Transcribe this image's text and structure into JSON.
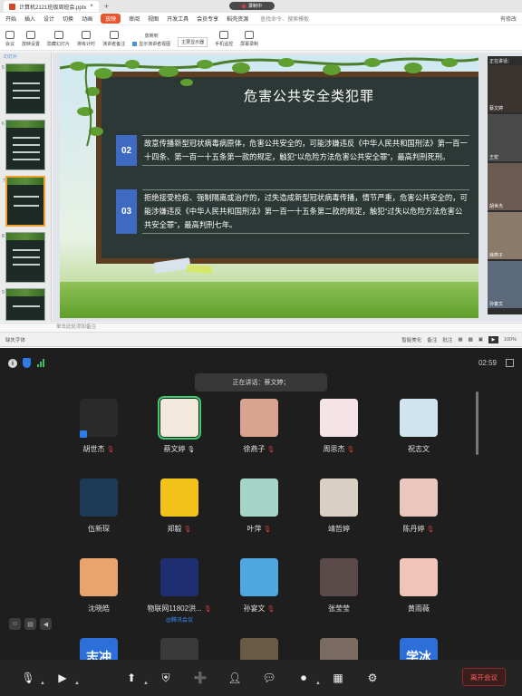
{
  "wps": {
    "doc_tab": "计算机2121班级周班会.pptx",
    "rec_label": "录制中",
    "menu": [
      "开始",
      "插入",
      "设计",
      "切换",
      "动画",
      "放映",
      "审阅",
      "视图",
      "开发工具",
      "会员专享",
      "稻壳资源"
    ],
    "menu_active": "放映",
    "search": "查找命令、搜索模板",
    "collab": "有修改",
    "ribbon": [
      "会议",
      "放映设置",
      "隐藏幻灯片",
      "排练计时",
      "演讲者备注",
      "放映到",
      "主要显示器",
      "显示演讲者视图",
      "手机遥控",
      "屏幕录制"
    ],
    "pane_label": "幻灯片",
    "thumb_numbers": [
      "5",
      "6",
      "7",
      "8",
      "9"
    ],
    "slide": {
      "title": "危害公共安全类犯罪",
      "items": [
        {
          "num": "02",
          "text": "故意传播新型冠状病毒病原体，危害公共安全的，可能涉嫌违反《中华人民共和国刑法》第一百一十四条、第一百一十五条第一款的规定，触犯“以危险方法危害公共安全罪”，最高判刑死刑。"
        },
        {
          "num": "03",
          "text": "拒绝接受检疫、强制隔离或治疗的，过失造成新型冠状病毒传播，情节严重，危害公共安全的，可能涉嫌违反《中华人民共和国刑法》第一百一十五条第二款的规定，触犯“过失以危险方法危害公共安全罪”，最高判刑七年。"
        }
      ]
    },
    "cam_label": "正在讲话：",
    "cams": [
      "蔡文婷",
      "王宏",
      "胡世杰",
      "徐燕子",
      "周思杰",
      "祝志文",
      "孙宴文"
    ],
    "notes": "单击此处添加备注",
    "status_left": "缺失字体",
    "status_right": [
      "智能美化",
      "备注",
      "批注",
      "100%"
    ]
  },
  "meeting": {
    "time": "02:59",
    "speaking": "正在讲话：蔡文婷；",
    "tiles": [
      {
        "name": "胡世杰",
        "mic": "off",
        "color": "#2a2a2a",
        "glyph": "",
        "host": true
      },
      {
        "name": "蔡文婷",
        "mic": "on",
        "color": "#f2e9dc",
        "glyph": "",
        "ring": true
      },
      {
        "name": "徐燕子",
        "mic": "off",
        "color": "#d9a38f",
        "glyph": ""
      },
      {
        "name": "周思杰",
        "mic": "off",
        "color": "#f6e3e8",
        "glyph": ""
      },
      {
        "name": "祝志文",
        "mic": "",
        "color": "#cfe4ef",
        "glyph": ""
      },
      {
        "name": "伍新琛",
        "mic": "",
        "color": "#1e3a55",
        "glyph": ""
      },
      {
        "name": "郑毅",
        "mic": "off",
        "color": "#f2c21a",
        "glyph": ""
      },
      {
        "name": "叶萍",
        "mic": "off",
        "color": "#a7d4c9",
        "glyph": ""
      },
      {
        "name": "靖哲婷",
        "mic": "",
        "color": "#d9cfc2",
        "glyph": ""
      },
      {
        "name": "陈丹婷",
        "mic": "off",
        "color": "#e9c7bd",
        "glyph": ""
      },
      {
        "name": "沈晓皓",
        "mic": "",
        "color": "#e9a36c",
        "glyph": ""
      },
      {
        "name": "物联网11802洪...",
        "mic": "off",
        "color": "#1e2e70",
        "glyph": "",
        "sub": "@腾讯会议"
      },
      {
        "name": "孙宴文",
        "mic": "off",
        "color": "#4fa7e2",
        "glyph": ""
      },
      {
        "name": "张莹莹",
        "mic": "",
        "color": "#5a4a4a",
        "glyph": ""
      },
      {
        "name": "黄雨薇",
        "mic": "",
        "color": "#f0c4b8",
        "glyph": ""
      },
      {
        "name": "",
        "mic": "",
        "color": "#2c6fd8",
        "glyph": "志冲"
      },
      {
        "name": "",
        "mic": "",
        "color": "#3a3a3a",
        "glyph": ""
      },
      {
        "name": "",
        "mic": "",
        "color": "#6b5a45",
        "glyph": ""
      },
      {
        "name": "",
        "mic": "",
        "color": "#7a6a60",
        "glyph": ""
      },
      {
        "name": "",
        "mic": "",
        "color": "#2c6fd8",
        "glyph": "学冰"
      }
    ],
    "toolbar": [
      "mic-off",
      "camera-off",
      "share",
      "security",
      "invite",
      "members",
      "chat",
      "record",
      "apps",
      "settings"
    ],
    "leave": "离开会议"
  }
}
